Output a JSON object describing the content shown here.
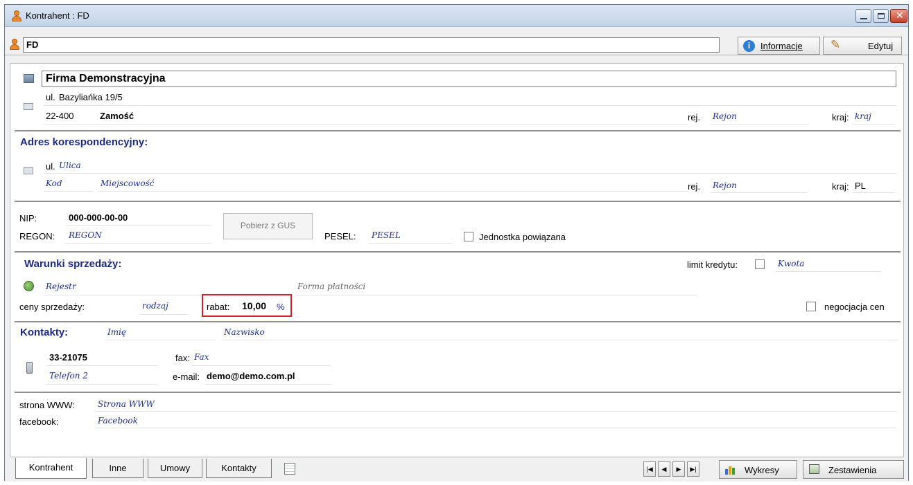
{
  "window": {
    "title": "Kontrahent : FD"
  },
  "namebar": {
    "code": "FD",
    "info_label": "Informacje",
    "edit_label": "Edytuj"
  },
  "main": {
    "company_name": "Firma Demonstracyjna",
    "street_prefix": "ul.",
    "street": "Bazyliańka 19/5",
    "postal_code": "22-400",
    "city": "Zamość",
    "region_label": "rej.",
    "region_placeholder": "Rejon",
    "country_label": "kraj:",
    "country_placeholder": "kraj"
  },
  "correspondence": {
    "title": "Adres korespondencyjny:",
    "street_prefix": "ul.",
    "street_placeholder": "Ulica",
    "code_placeholder": "Kod",
    "city_placeholder": "Miejscowość",
    "region_label": "rej.",
    "region_placeholder": "Rejon",
    "country_label": "kraj:",
    "country": "PL"
  },
  "ids": {
    "nip_label": "NIP:",
    "nip": "000-000-00-00",
    "regon_label": "REGON:",
    "regon_placeholder": "REGON",
    "gus_button": "Pobierz z GUS",
    "pesel_label": "PESEL:",
    "pesel_placeholder": "PESEL",
    "related_label": "Jednostka powiązana"
  },
  "sales": {
    "title": "Warunki sprzedaży:",
    "credit_label": "limit kredytu:",
    "credit_placeholder": "Kwota",
    "register_placeholder": "Rejestr",
    "payment_placeholder": "Forma płatności",
    "prices_label": "ceny sprzedaży:",
    "kind_placeholder": "rodzaj",
    "discount_label": "rabat:",
    "discount_value": "10,00",
    "discount_unit": "%",
    "negotiation_label": "negocjacja cen"
  },
  "contacts": {
    "title": "Kontakty:",
    "first_name_placeholder": "Imię",
    "last_name_placeholder": "Nazwisko",
    "phone": "33-21075",
    "fax_label": "fax:",
    "fax_placeholder": "Fax",
    "phone2_placeholder": "Telefon 2",
    "email_label": "e-mail:",
    "email": "demo@demo.com.pl"
  },
  "web": {
    "www_label": "strona WWW:",
    "www_placeholder": "Strona WWW",
    "facebook_label": "facebook:",
    "facebook_placeholder": "Facebook"
  },
  "tabs": [
    {
      "label": "Kontrahent"
    },
    {
      "label": "Inne"
    },
    {
      "label": "Umowy"
    },
    {
      "label": "Kontakty"
    }
  ],
  "bottom": {
    "charts_label": "Wykresy",
    "summaries_label": "Zestawienia"
  },
  "colors": {
    "accent_blue": "#1c2a80",
    "highlight_red": "#d4202a"
  }
}
